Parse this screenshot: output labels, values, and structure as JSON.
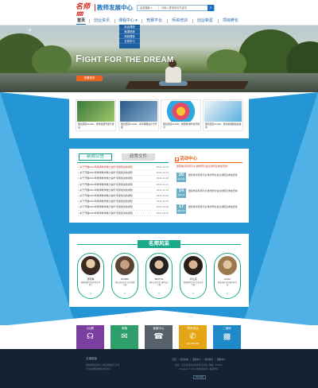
{
  "header": {
    "logo_mark": "名师网",
    "title": "教师发展中心",
    "search": {
      "scope": "全站搜索 ▾",
      "placeholder": "请输入要搜索的关键词",
      "button_icon": "search-icon"
    }
  },
  "nav": {
    "items": [
      {
        "label": "首页",
        "active": true
      },
      {
        "label": "创业资讯"
      },
      {
        "label": "课程中心 ▾"
      },
      {
        "label": "竞赛平台"
      },
      {
        "label": "师资培训"
      },
      {
        "label": "创业新星"
      },
      {
        "label": "项目孵化"
      }
    ],
    "dropdown": [
      "精品课程",
      "微课视频",
      "网络课堂",
      "在线学习"
    ]
  },
  "banner": {
    "headline_first": "F",
    "headline_rest": "IGHT FOR THE DREAM",
    "button": "查看更多"
  },
  "courses": [
    {
      "caption": "国创项目FLASH，教学资源开发与建设"
    },
    {
      "caption": "国创项目FLASH，系列课程设计与开发"
    },
    {
      "caption": "国创项目FLASH，微课程 制作技巧研讨"
    },
    {
      "caption": "国创项目FLASH，移动端课程建设探索"
    }
  ],
  "news": {
    "tab_active": "新闻公告",
    "tab_other": "政策文件",
    "rows": [
      {
        "text": "关于开展2021年教师教学能力提升专题培训的通知",
        "date": "2021-12-19",
        "hot": true
      },
      {
        "text": "关于开展2021年教师教学能力提升专题培训的通知",
        "date": "2021-12-19"
      },
      {
        "text": "关于开展2021年教师教学能力提升专题培训的通知",
        "date": "2021-11-28"
      },
      {
        "text": "关于开展2021年教师教学能力提升专题培训的通知",
        "date": "2021-11-21"
      },
      {
        "text": "关于开展2021年教师教学能力提升专题培训的通知",
        "date": "2021-11-10"
      },
      {
        "text": "关于开展2021年教师教学能力提升专题培训的通知",
        "date": "2021-11-08"
      },
      {
        "text": "关于开展2021年教师教学能力提升专题培训的通知",
        "date": "2021-11-03"
      },
      {
        "text": "关于开展2021年教师教学能力提升专题培训的通知",
        "date": "2021-10-28"
      },
      {
        "text": "关于开展2021年教师教学能力提升专题培训的通知",
        "date": "2021-10-15"
      }
    ]
  },
  "activity": {
    "title": "活动中心",
    "icon": "calendar-icon",
    "hot_text": "国家重点科研平台 教学研讨会议通知及参会安排",
    "items": [
      {
        "day": "20",
        "month": "2021-11",
        "text": "国家重点科研平台 教学研讨会议通知及参会安排"
      },
      {
        "day": "14",
        "month": "2021-11",
        "text": "国家重点科研平台 教学研讨会议通知及参会安排"
      },
      {
        "day": "17",
        "month": "2021-10",
        "text": "国家重点科研平台 教学研讨会议通知及参会安排"
      }
    ]
  },
  "teachers": {
    "title": "名师风采",
    "list": [
      {
        "name": "贾晓琳",
        "desc": "国家级教学名师 教育学博士"
      },
      {
        "name": "ROBIN",
        "desc": "知名创业导师 企业管理专家"
      },
      {
        "name": "BRITTE",
        "desc": "国际交流学者 课程设计专家"
      },
      {
        "name": "卢礼源",
        "desc": "省级教学名师 信息技术专家"
      },
      {
        "name": "JULIA",
        "desc": "客座讲师 外语教学研究者"
      }
    ],
    "more": "▾"
  },
  "contact": [
    {
      "label": "QQ群",
      "icon": "headset-icon",
      "sub": "",
      "color": "#7b3fa0"
    },
    {
      "label": "邮箱",
      "icon": "mail-icon",
      "sub": "",
      "color": "#2e9e6a"
    },
    {
      "label": "客服中心",
      "icon": "chat-icon",
      "sub": "",
      "color": "#56616b"
    },
    {
      "label": "联系电话",
      "icon": "phone-icon",
      "sub": "400-1234-567",
      "color": "#e6a515"
    },
    {
      "label": "二维码",
      "icon": "qrcode-icon",
      "sub": "",
      "color": "#1f8ac9"
    }
  ],
  "footer": {
    "title": "友情链接",
    "lines": [
      "国家教师发展中心 教育部教师工作司",
      "全国高校教师网络培训中心"
    ],
    "links": [
      "首页",
      "新闻动态",
      "课程中心",
      "联系我们",
      "帮助中心"
    ],
    "address": "地址：某某省某某市某某区某某路 | 邮编：000000",
    "copyright": "Copyright © 2021 教师发展中心 版权所有",
    "badge": "网站地图"
  }
}
